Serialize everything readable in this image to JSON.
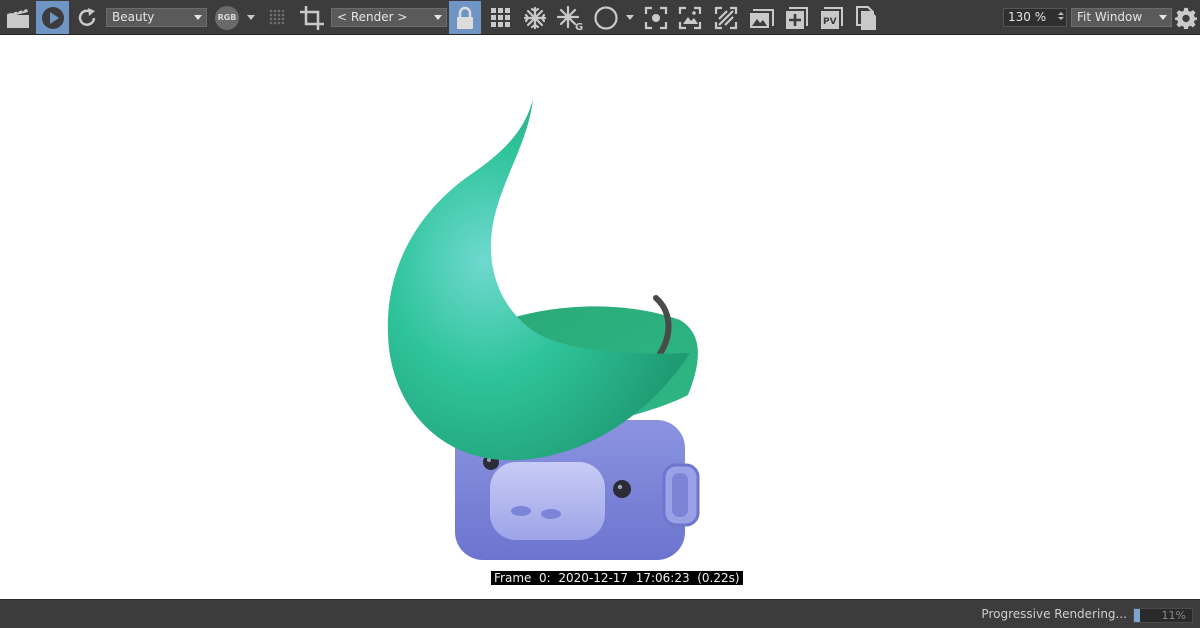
{
  "toolbar": {
    "pass_select": "Beauty",
    "channel_badge": "RGB",
    "render_select": "< Render >",
    "zoom_value": "130 %",
    "fit_select": "Fit Window",
    "active_color": "#6e95c4",
    "icons": [
      "clapper-icon",
      "play-render-icon",
      "refresh-icon",
      "rgb-channel-icon",
      "grid-dots-icon",
      "crop-icon",
      "lock-icon",
      "grid-icon",
      "snowflake-icon",
      "snowflake-g-icon",
      "circle-icon",
      "focus-icon",
      "image-frame-icon",
      "crosshatch-icon",
      "picture-icon",
      "add-icon",
      "pv-icon",
      "copy-icon",
      "gear-icon"
    ],
    "pv_label": "PV",
    "g_label": "G"
  },
  "viewport": {
    "frame_info": "Frame  0:  2020-12-17  17:06:23  (0.22s)"
  },
  "statusbar": {
    "status_text": "Progressive Rendering...",
    "progress_percent": 11,
    "progress_label": "11%"
  }
}
